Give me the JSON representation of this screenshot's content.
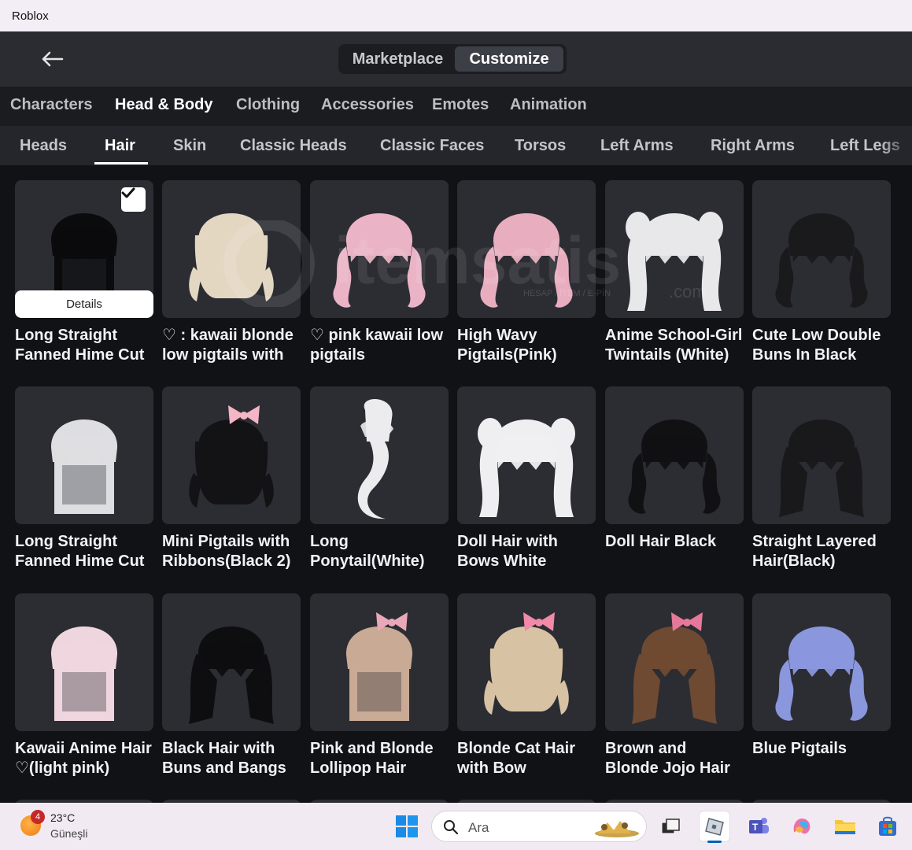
{
  "window": {
    "title": "Roblox"
  },
  "header": {
    "tabs": [
      "Marketplace",
      "Customize"
    ],
    "active_tab": "Customize"
  },
  "categories": [
    "Characters",
    "Head & Body",
    "Clothing",
    "Accessories",
    "Emotes",
    "Animation"
  ],
  "active_category": "Head & Body",
  "subcategories": [
    "Heads",
    "Hair",
    "Skin",
    "Classic Heads",
    "Classic Faces",
    "Torsos",
    "Left Arms",
    "Right Arms",
    "Left Legs"
  ],
  "active_subcategory": "Hair",
  "details_label": "Details",
  "items": [
    {
      "name": "Long Straight Fanned Hime Cut",
      "color": "#0b0b0d",
      "style": "straight",
      "equipped": true
    },
    {
      "name": "♡ : kawaii blonde low pigtails with",
      "color": "#e3d7c2",
      "style": "bob"
    },
    {
      "name": "♡ pink kawaii low pigtails",
      "color": "#eab4c6",
      "style": "pigtails"
    },
    {
      "name": "High Wavy Pigtails(Pink)",
      "color": "#e8aebf",
      "style": "pigtails"
    },
    {
      "name": "Anime School-Girl Twintails (White)",
      "color": "#e8e8ea",
      "style": "twintails"
    },
    {
      "name": "Cute Low Double Buns In Black",
      "color": "#1a1a1c",
      "style": "pigtails"
    },
    {
      "name": "Long Straight Fanned Hime Cut",
      "color": "#dedee2",
      "style": "straight"
    },
    {
      "name": "Mini Pigtails with Ribbons(Black 2)",
      "color": "#131315",
      "style": "bob",
      "accent": "#f4b5c6"
    },
    {
      "name": "Long Ponytail(White)",
      "color": "#ececee",
      "style": "ponytail"
    },
    {
      "name": "Doll Hair with Bows White",
      "color": "#efeff1",
      "style": "twintails"
    },
    {
      "name": "Doll Hair Black",
      "color": "#111113",
      "style": "pigtails"
    },
    {
      "name": "Straight Layered Hair(Black)",
      "color": "#19191b",
      "style": "layered"
    },
    {
      "name": "Kawaii Anime Hair ♡(light pink)",
      "color": "#efd6de",
      "style": "straight"
    },
    {
      "name": "Black Hair with Buns and Bangs",
      "color": "#0e0e10",
      "style": "layered"
    },
    {
      "name": "Pink and Blonde Lollipop Hair",
      "color": "#c9aa95",
      "style": "straight",
      "accent": "#e9a8b8"
    },
    {
      "name": "Blonde Cat Hair with Bow",
      "color": "#d8c2a4",
      "style": "bob",
      "accent": "#f08aa8"
    },
    {
      "name": "Brown and Blonde Jojo Hair",
      "color": "#6f4a32",
      "style": "layered",
      "accent": "#e6799a"
    },
    {
      "name": "Blue Pigtails",
      "color": "#8a97dd",
      "style": "pigtails"
    }
  ],
  "watermark": {
    "brand": "itemsatis",
    "domain": ".com",
    "tagline": "HESAP / İTEM / E-PİN"
  },
  "taskbar": {
    "weather_temp": "23°C",
    "weather_desc": "Güneşli",
    "weather_badge": "4",
    "search_placeholder": "Ara",
    "apps": [
      "start-icon",
      "task-view-icon",
      "roblox-icon",
      "teams-icon",
      "copilot-icon",
      "file-explorer-icon",
      "store-icon"
    ]
  }
}
